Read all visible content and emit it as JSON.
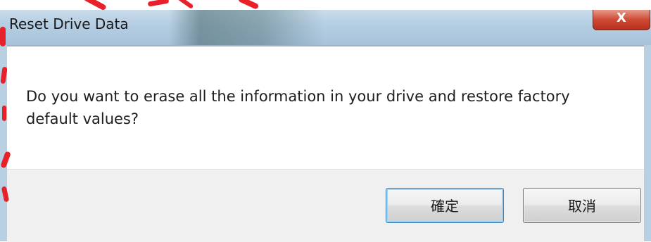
{
  "window": {
    "title": "Reset Drive Data",
    "close_glyph": "X"
  },
  "message": {
    "text": "Do you want to erase all the information in your drive and restore factory default values?"
  },
  "buttons": {
    "ok_label": "確定",
    "cancel_label": "取消"
  },
  "colors": {
    "annotation": "#e8202a",
    "titlebar": "#b4cde2",
    "close": "#cf4a35"
  }
}
